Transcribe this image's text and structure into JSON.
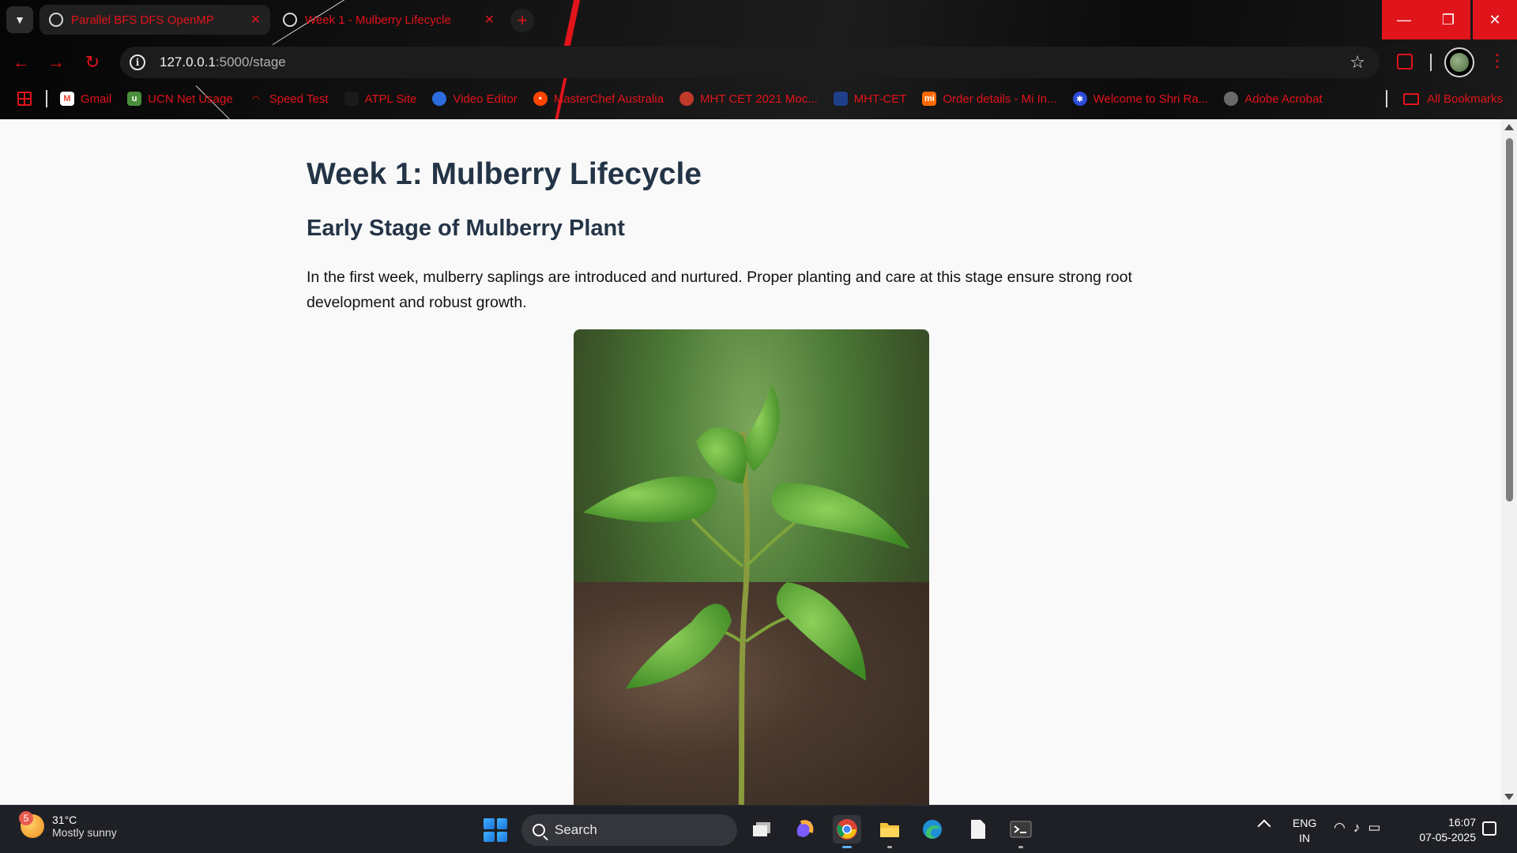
{
  "browser": {
    "tabs": [
      {
        "title": "Parallel BFS DFS OpenMP",
        "active": false
      },
      {
        "title": "Week 1 - Mulberry Lifecycle",
        "active": true
      }
    ],
    "url_host": "127.0.0.1",
    "url_path": ":5000/stage",
    "bookmarks": [
      {
        "label": "Gmail",
        "icon": "gmail-icon",
        "color": "#ea4335"
      },
      {
        "label": "UCN Net Usage",
        "icon": "ucn-icon",
        "color": "#4a8f3c"
      },
      {
        "label": "Speed Test",
        "icon": "speed-icon",
        "color": "#e3131b"
      },
      {
        "label": "ATPL Site",
        "icon": "atpl-icon",
        "color": "#1a1a1a"
      },
      {
        "label": "Video Editor",
        "icon": "video-editor-icon",
        "color": "#2d6cdf"
      },
      {
        "label": "MasterChef Australia",
        "icon": "reddit-icon",
        "color": "#ff4500"
      },
      {
        "label": "MHT CET 2021 Moc...",
        "icon": "mht-cet-icon",
        "color": "#c0392b"
      },
      {
        "label": "MHT-CET",
        "icon": "mht-icon",
        "color": "#1f3f8a"
      },
      {
        "label": "Order details - Mi In...",
        "icon": "mi-icon",
        "color": "#ff6900"
      },
      {
        "label": "Welcome to Shri Ra...",
        "icon": "shri-icon",
        "color": "#2b4bd8"
      },
      {
        "label": "Adobe Acrobat",
        "icon": "globe-icon",
        "color": "#6a6a6a"
      }
    ],
    "all_bookmarks": "All Bookmarks"
  },
  "page": {
    "title": "Week 1: Mulberry Lifecycle",
    "subtitle": "Early Stage of Mulberry Plant",
    "paragraph": "In the first week, mulberry saplings are introduced and nurtured. Proper planting and care at this stage ensure strong root development and robust growth."
  },
  "taskbar": {
    "weather_badge": "5",
    "temperature": "31°C",
    "condition": "Mostly sunny",
    "search_label": "Search",
    "lang_top": "ENG",
    "lang_bottom": "IN",
    "time": "16:07",
    "date": "07-05-2025"
  }
}
